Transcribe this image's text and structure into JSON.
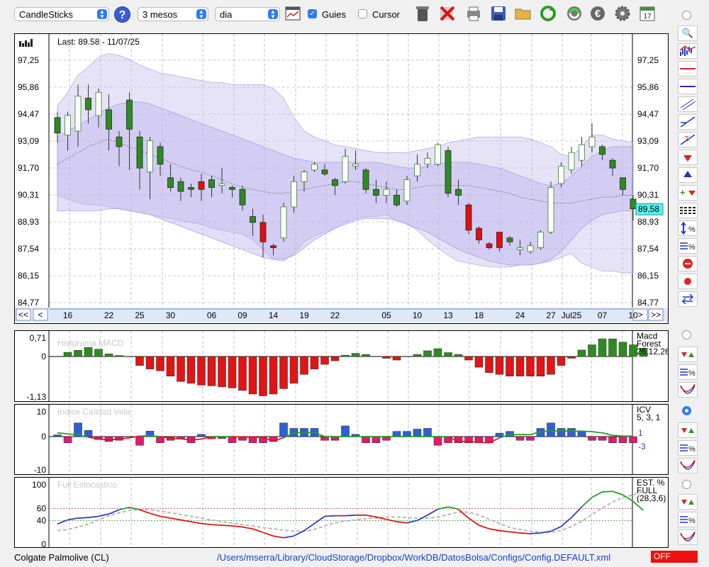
{
  "toolbar": {
    "chart_type": "CandleSticks",
    "period": "3 mesos",
    "interval": "dia",
    "guides_label": "Guies",
    "guides_checked": true,
    "cursor_label": "Cursor",
    "cursor_checked": false,
    "icons": [
      "help-icon",
      "calendar-grid-icon",
      "trash-icon",
      "delete-x-icon",
      "print-icon",
      "save-icon",
      "open-folder-icon",
      "refresh-icon",
      "sync-icon",
      "euro-icon",
      "gear-icon",
      "calendar-icon"
    ]
  },
  "colors": {
    "bull": "#2e8b22",
    "bear": "#e01010",
    "band": "#c8c0ee",
    "blue": "#2c3fc8",
    "green": "#2a9a2a",
    "red": "#e01515",
    "stoch_avg": "#b8b8b8",
    "icv_pos": "#2c5fd8",
    "icv_neg": "#e01a70"
  },
  "price_chart": {
    "last_label": "Last: 89.58 - 11/07/25",
    "price_tag": "89,58",
    "nav_buttons": [
      "<<",
      "<",
      ">",
      ">>"
    ],
    "date_labels": [
      {
        "label": "16",
        "i": 1
      },
      {
        "label": "22",
        "i": 5
      },
      {
        "label": "25",
        "i": 8
      },
      {
        "label": "30",
        "i": 11
      },
      {
        "label": "06",
        "i": 15
      },
      {
        "label": "09",
        "i": 18
      },
      {
        "label": "14",
        "i": 21
      },
      {
        "label": "19",
        "i": 24
      },
      {
        "label": "22",
        "i": 27
      },
      {
        "label": "05",
        "i": 32
      },
      {
        "label": "10",
        "i": 35
      },
      {
        "label": "13",
        "i": 38
      },
      {
        "label": "18",
        "i": 41
      },
      {
        "label": "24",
        "i": 45
      },
      {
        "label": "27",
        "i": 48
      },
      {
        "label": "Jul25",
        "i": 50
      },
      {
        "label": "07",
        "i": 53
      },
      {
        "label": "10",
        "i": 56
      }
    ]
  },
  "chart_data": [
    {
      "type": "candlestick",
      "title": "",
      "y_ticks": [
        "84,77",
        "86,15",
        "87,54",
        "88,93",
        "90,31",
        "91,70",
        "93,09",
        "94,47",
        "95,86",
        "97,25"
      ],
      "ylim": [
        84.77,
        98.64
      ],
      "grid": true,
      "candles": [
        [
          94.3,
          93.5,
          94.6,
          93.0
        ],
        [
          93.4,
          94.4,
          94.6,
          92.6
        ],
        [
          93.6,
          95.4,
          96.0,
          92.8
        ],
        [
          95.3,
          94.7,
          96.0,
          94.0
        ],
        [
          94.4,
          95.6,
          95.8,
          93.8
        ],
        [
          94.7,
          93.7,
          95.5,
          92.6
        ],
        [
          93.3,
          92.8,
          93.6,
          91.8
        ],
        [
          95.2,
          93.7,
          95.6,
          91.6
        ],
        [
          93.3,
          91.7,
          93.6,
          90.6
        ],
        [
          91.5,
          93.1,
          93.3,
          90.1
        ],
        [
          92.8,
          91.9,
          93.0,
          91.3
        ],
        [
          91.2,
          90.7,
          91.9,
          90.5
        ],
        [
          91.0,
          90.5,
          91.2,
          90.0
        ],
        [
          90.7,
          90.6,
          90.9,
          90.2
        ],
        [
          90.6,
          91.0,
          91.4,
          90.0
        ],
        [
          91.1,
          90.7,
          91.3,
          90.2
        ],
        [
          90.8,
          90.9,
          91.7,
          90.4
        ],
        [
          90.7,
          90.6,
          90.8,
          90.2
        ],
        [
          90.6,
          89.8,
          90.8,
          89.5
        ],
        [
          89.2,
          88.9,
          89.6,
          88.2
        ],
        [
          88.9,
          87.9,
          89.3,
          87.1
        ],
        [
          87.6,
          87.7,
          87.8,
          87.2
        ],
        [
          88.1,
          89.7,
          89.9,
          87.9
        ],
        [
          89.7,
          91.0,
          91.3,
          89.4
        ],
        [
          91.0,
          91.5,
          91.6,
          90.5
        ],
        [
          91.6,
          91.9,
          92.0,
          91.5
        ],
        [
          91.6,
          91.4,
          91.9,
          91.3
        ],
        [
          91.1,
          90.8,
          91.2,
          90.3
        ],
        [
          91.0,
          92.3,
          92.7,
          90.9
        ],
        [
          91.8,
          91.9,
          92.6,
          91.6
        ],
        [
          91.6,
          90.6,
          91.7,
          90.4
        ],
        [
          90.6,
          90.3,
          91.1,
          89.9
        ],
        [
          90.3,
          90.6,
          91.0,
          89.9
        ],
        [
          90.3,
          89.8,
          90.6,
          89.7
        ],
        [
          90.0,
          91.1,
          91.3,
          89.8
        ],
        [
          91.3,
          91.9,
          92.4,
          91.0
        ],
        [
          91.9,
          92.2,
          92.5,
          91.7
        ],
        [
          91.9,
          92.9,
          93.0,
          91.8
        ],
        [
          92.6,
          90.4,
          92.8,
          90.2
        ],
        [
          90.6,
          90.3,
          91.1,
          89.8
        ],
        [
          89.8,
          88.5,
          89.9,
          88.3
        ],
        [
          88.6,
          88.0,
          88.7,
          87.8
        ],
        [
          87.8,
          87.6,
          87.9,
          87.5
        ],
        [
          87.6,
          88.4,
          88.4,
          87.4
        ],
        [
          88.1,
          87.9,
          88.2,
          87.7
        ],
        [
          87.5,
          87.6,
          88.0,
          87.2
        ],
        [
          87.4,
          87.7,
          87.9,
          87.3
        ],
        [
          87.6,
          88.4,
          88.5,
          87.5
        ],
        [
          88.4,
          90.7,
          91.0,
          88.3
        ],
        [
          90.9,
          91.8,
          92.0,
          90.7
        ],
        [
          91.6,
          92.5,
          92.8,
          91.4
        ],
        [
          92.1,
          92.9,
          93.3,
          91.8
        ],
        [
          92.8,
          93.3,
          94.0,
          92.5
        ],
        [
          92.8,
          92.4,
          92.9,
          92.1
        ],
        [
          92.1,
          91.7,
          92.2,
          91.3
        ],
        [
          91.2,
          90.6,
          91.2,
          90.3
        ],
        [
          90.1,
          89.6,
          90.3,
          89.0
        ]
      ],
      "bollinger_upper": [
        94.9,
        95.6,
        96.5,
        96.9,
        97.4,
        97.6,
        97.5,
        97.3,
        97.0,
        96.8,
        96.6,
        96.5,
        96.4,
        96.3,
        96.2,
        96.1,
        96.1,
        96.0,
        96.0,
        96.0,
        96.0,
        95.8,
        95.3,
        94.3,
        93.6,
        93.3,
        93.1,
        92.9,
        92.8,
        92.7,
        92.6,
        92.5,
        92.5,
        92.5,
        92.5,
        92.6,
        92.7,
        92.8,
        93.0,
        93.1,
        93.2,
        93.3,
        93.3,
        93.3,
        93.3,
        93.3,
        93.2,
        93.0,
        92.8,
        92.4,
        92.3,
        92.8,
        93.4,
        93.4,
        93.2,
        93.1,
        93.0
      ],
      "bollinger_mid": [
        91.9,
        92.2,
        92.5,
        92.8,
        93.0,
        93.2,
        93.0,
        92.8,
        92.6,
        92.4,
        92.2,
        92.0,
        91.8,
        91.6,
        91.5,
        91.3,
        91.1,
        90.9,
        90.7,
        90.6,
        90.5,
        90.4,
        90.4,
        90.5,
        90.6,
        90.7,
        90.8,
        90.9,
        91.0,
        91.0,
        90.9,
        90.8,
        90.7,
        90.6,
        90.6,
        90.7,
        90.8,
        90.8,
        90.8,
        90.8,
        90.8,
        90.7,
        90.6,
        90.5,
        90.4,
        90.2,
        90.1,
        90.0,
        89.9,
        89.9,
        89.9,
        90.0,
        90.1,
        90.2,
        90.2,
        90.3,
        90.3
      ],
      "bollinger_lower": [
        90.3,
        90.1,
        89.9,
        89.8,
        89.8,
        89.7,
        89.6,
        89.5,
        89.4,
        89.3,
        89.2,
        89.1,
        89.0,
        88.9,
        88.8,
        88.6,
        88.5,
        88.4,
        88.3,
        88.0,
        87.5,
        87.0,
        86.9,
        87.3,
        87.9,
        88.2,
        88.4,
        88.6,
        88.9,
        89.1,
        89.2,
        89.2,
        89.3,
        89.0,
        88.8,
        88.5,
        88.0,
        87.6,
        87.2,
        86.9,
        86.8,
        86.7,
        86.6,
        86.6,
        86.6,
        86.7,
        86.7,
        86.8,
        86.9,
        87.1,
        87.3,
        86.8,
        86.6,
        86.4,
        86.4,
        86.3,
        86.3
      ],
      "keltner_upper": [
        93.3,
        93.6,
        93.9,
        94.2,
        94.5,
        94.8,
        95.0,
        95.1,
        95.1,
        95.0,
        94.8,
        94.6,
        94.4,
        94.2,
        94.0,
        93.8,
        93.6,
        93.4,
        93.2,
        93.0,
        92.8,
        92.6,
        92.4,
        92.2,
        92.1,
        92.0,
        92.0,
        92.0,
        92.0,
        92.0,
        92.0,
        92.0,
        91.9,
        91.8,
        91.7,
        91.7,
        91.8,
        91.9,
        92.0,
        92.0,
        92.0,
        91.9,
        91.8,
        91.7,
        91.5,
        91.3,
        91.1,
        90.9,
        90.8,
        90.9,
        91.3,
        91.8,
        92.3,
        92.6,
        92.8,
        92.8,
        92.8
      ],
      "keltner_lower": [
        89.5,
        89.5,
        89.5,
        89.5,
        89.5,
        89.6,
        89.6,
        89.5,
        89.4,
        89.3,
        89.1,
        88.9,
        88.7,
        88.5,
        88.3,
        88.1,
        87.9,
        87.7,
        87.5,
        87.3,
        87.1,
        87.0,
        87.0,
        87.2,
        87.6,
        88.0,
        88.3,
        88.6,
        88.8,
        89.0,
        89.1,
        89.1,
        89.1,
        89.0,
        88.8,
        88.6,
        88.4,
        88.1,
        87.8,
        87.5,
        87.3,
        87.1,
        86.9,
        86.8,
        86.7,
        86.7,
        86.7,
        86.8,
        87.0,
        87.4,
        88.0,
        88.6,
        89.0,
        89.3,
        89.4,
        89.5,
        89.5
      ]
    },
    {
      "type": "bar",
      "title": "Histgrama MACD",
      "right_label": [
        "Macd",
        "Forest",
        "26,12,26"
      ],
      "y_ticks": [
        "0,71",
        "0",
        "-1,13"
      ],
      "ylim": [
        -1.13,
        0.71
      ],
      "values": [
        0,
        0.16,
        0.24,
        0.35,
        0.28,
        0.1,
        0.04,
        0,
        -0.25,
        -0.35,
        -0.4,
        -0.55,
        -0.7,
        -0.75,
        -0.8,
        -0.82,
        -0.85,
        -0.88,
        -0.95,
        -1.05,
        -1.1,
        -1.05,
        -0.9,
        -0.75,
        -0.5,
        -0.35,
        -0.22,
        -0.12,
        0.05,
        0.12,
        0.08,
        0,
        -0.05,
        -0.1,
        0,
        0.08,
        0.22,
        0.3,
        0.15,
        0.08,
        -0.1,
        -0.3,
        -0.45,
        -0.5,
        -0.55,
        -0.55,
        -0.55,
        -0.55,
        -0.5,
        -0.25,
        -0.05,
        0.25,
        0.45,
        0.68,
        0.68,
        0.55,
        0.45,
        0.32
      ]
    },
    {
      "type": "bar+line",
      "title": "Indice Calidad Vela",
      "right_label": [
        "ICV",
        "5, 3, 1"
      ],
      "legend_values": [
        "1",
        "-3"
      ],
      "y_ticks": [
        "10",
        "0",
        "-10"
      ],
      "ylim": [
        -10,
        10
      ],
      "values": [
        0.7,
        -2.5,
        5.5,
        2.5,
        -1.2,
        -2.0,
        -1.5,
        0,
        -3.5,
        2.2,
        -2.5,
        -1.5,
        -0.8,
        -2.5,
        0.9,
        -0.9,
        -0.8,
        -2.5,
        -1.5,
        -2.5,
        -2.5,
        -2.0,
        5.5,
        3.3,
        3.3,
        3.3,
        -1.5,
        -1.5,
        4.3,
        0.9,
        -2.5,
        -2.5,
        -1.5,
        2.1,
        2.1,
        3.0,
        3.3,
        -3.5,
        -2.5,
        -2.5,
        -2.5,
        -2.5,
        -2.5,
        1.4,
        2.1,
        -1.5,
        -1.5,
        3.3,
        5.5,
        3.3,
        3.3,
        2.1,
        -1.5,
        -1.5,
        -2.5,
        -2.5,
        -2.5
      ],
      "line": [
        1.5,
        1.1,
        0.6,
        -0.2,
        -1.0,
        -1.3,
        -1.0,
        -0.5,
        0.2,
        0.3,
        0,
        -0.6,
        -0.9,
        -1.4,
        -1.0,
        0,
        0,
        0,
        -0.2,
        -0.2,
        -0.3,
        -1.8,
        -0.5,
        1.6,
        1.6,
        1.6,
        0,
        0,
        0,
        0,
        0,
        0,
        0,
        0,
        0,
        0,
        0,
        0,
        0,
        -2.0,
        -2.0,
        -2.3,
        -2.5,
        -0.5,
        0.8,
        0.8,
        0.8,
        2.0,
        2.3,
        2.3,
        2.2,
        2.2,
        2.0,
        1.5,
        0.5,
        0.2,
        0.2
      ]
    },
    {
      "type": "line",
      "title": "Full Estocastico",
      "right_label": [
        "EST. %",
        "FULL",
        "(28,3,6)"
      ],
      "y_ticks": [
        "100",
        "60",
        "40",
        "0"
      ],
      "ylim": [
        0,
        100
      ],
      "reference_lines": [
        60,
        40
      ],
      "k": [
        34,
        41,
        44,
        45,
        47,
        51,
        58,
        62,
        58,
        52,
        47,
        44,
        41,
        38,
        35,
        33,
        32,
        31,
        29,
        26,
        20,
        14,
        11,
        14,
        23,
        35,
        47,
        48,
        48,
        49,
        49,
        46,
        42,
        38,
        36,
        40,
        49,
        59,
        63,
        59,
        44,
        32,
        26,
        23,
        21,
        19,
        18,
        19,
        22,
        30,
        45,
        63,
        79,
        88,
        89,
        83,
        72,
        57
      ],
      "d": [
        23,
        25,
        29,
        34,
        41,
        48,
        53,
        57,
        59,
        58,
        56,
        53,
        50,
        47,
        44,
        41,
        38,
        36,
        33,
        31,
        28,
        26,
        24,
        22,
        22,
        25,
        31,
        36,
        39,
        41,
        43,
        44,
        46,
        46,
        45,
        44,
        44,
        46,
        50,
        54,
        54,
        49,
        42,
        35,
        28,
        25,
        22,
        20,
        20,
        23,
        30,
        39,
        50,
        61,
        71,
        79,
        83,
        88
      ]
    }
  ],
  "status": {
    "left": "Colgate Palmolive (CL)",
    "path": "/Users/mserra/Library/CloudStorage/Dropbox/WorkDB/DatosBolsa/Configs/Config.DEFAULT.xml",
    "badge": "OFF"
  }
}
